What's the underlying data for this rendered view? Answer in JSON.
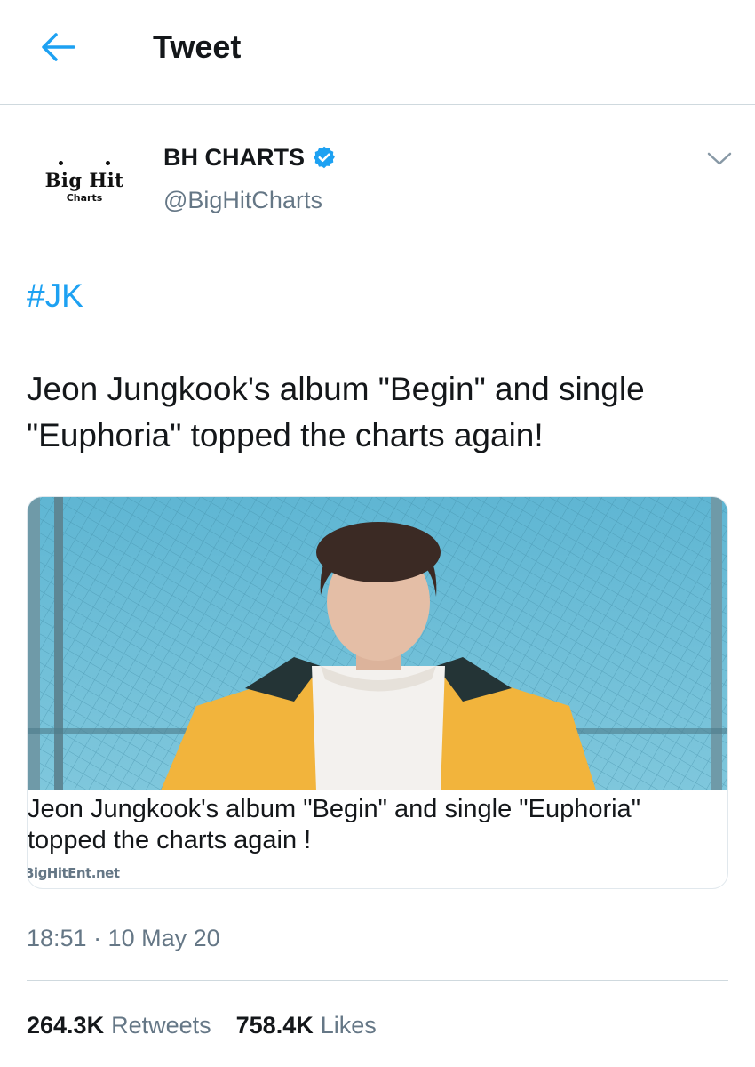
{
  "header": {
    "title": "Tweet",
    "back_icon": "arrow-left-icon"
  },
  "author": {
    "logo_text": "Big Hit",
    "logo_subtext": "Charts",
    "display_name": "BH CHARTS",
    "handle": "@BigHitCharts",
    "verified_icon": "verified-badge-icon",
    "menu_icon": "chevron-down-icon"
  },
  "tweet": {
    "hashtag": "#JK",
    "text": "Jeon Jungkook's album \"Begin\" and single \"Euphoria\" topped the charts again!",
    "timestamp": "18:51 · 10 May 20"
  },
  "card": {
    "title": "Jeon Jungkook's album \"Begin\" and single \"Euphoria\" topped the charts again !",
    "domain": "BigHitEnt.net",
    "image_icon": "link-preview-photo"
  },
  "stats": {
    "retweets_count": "264.3K",
    "retweets_label": "Retweets",
    "likes_count": "758.4K",
    "likes_label": "Likes"
  },
  "colors": {
    "accent": "#1da1f2",
    "secondary_text": "#657786",
    "primary_text": "#14171a",
    "divider": "#cfd9de"
  }
}
